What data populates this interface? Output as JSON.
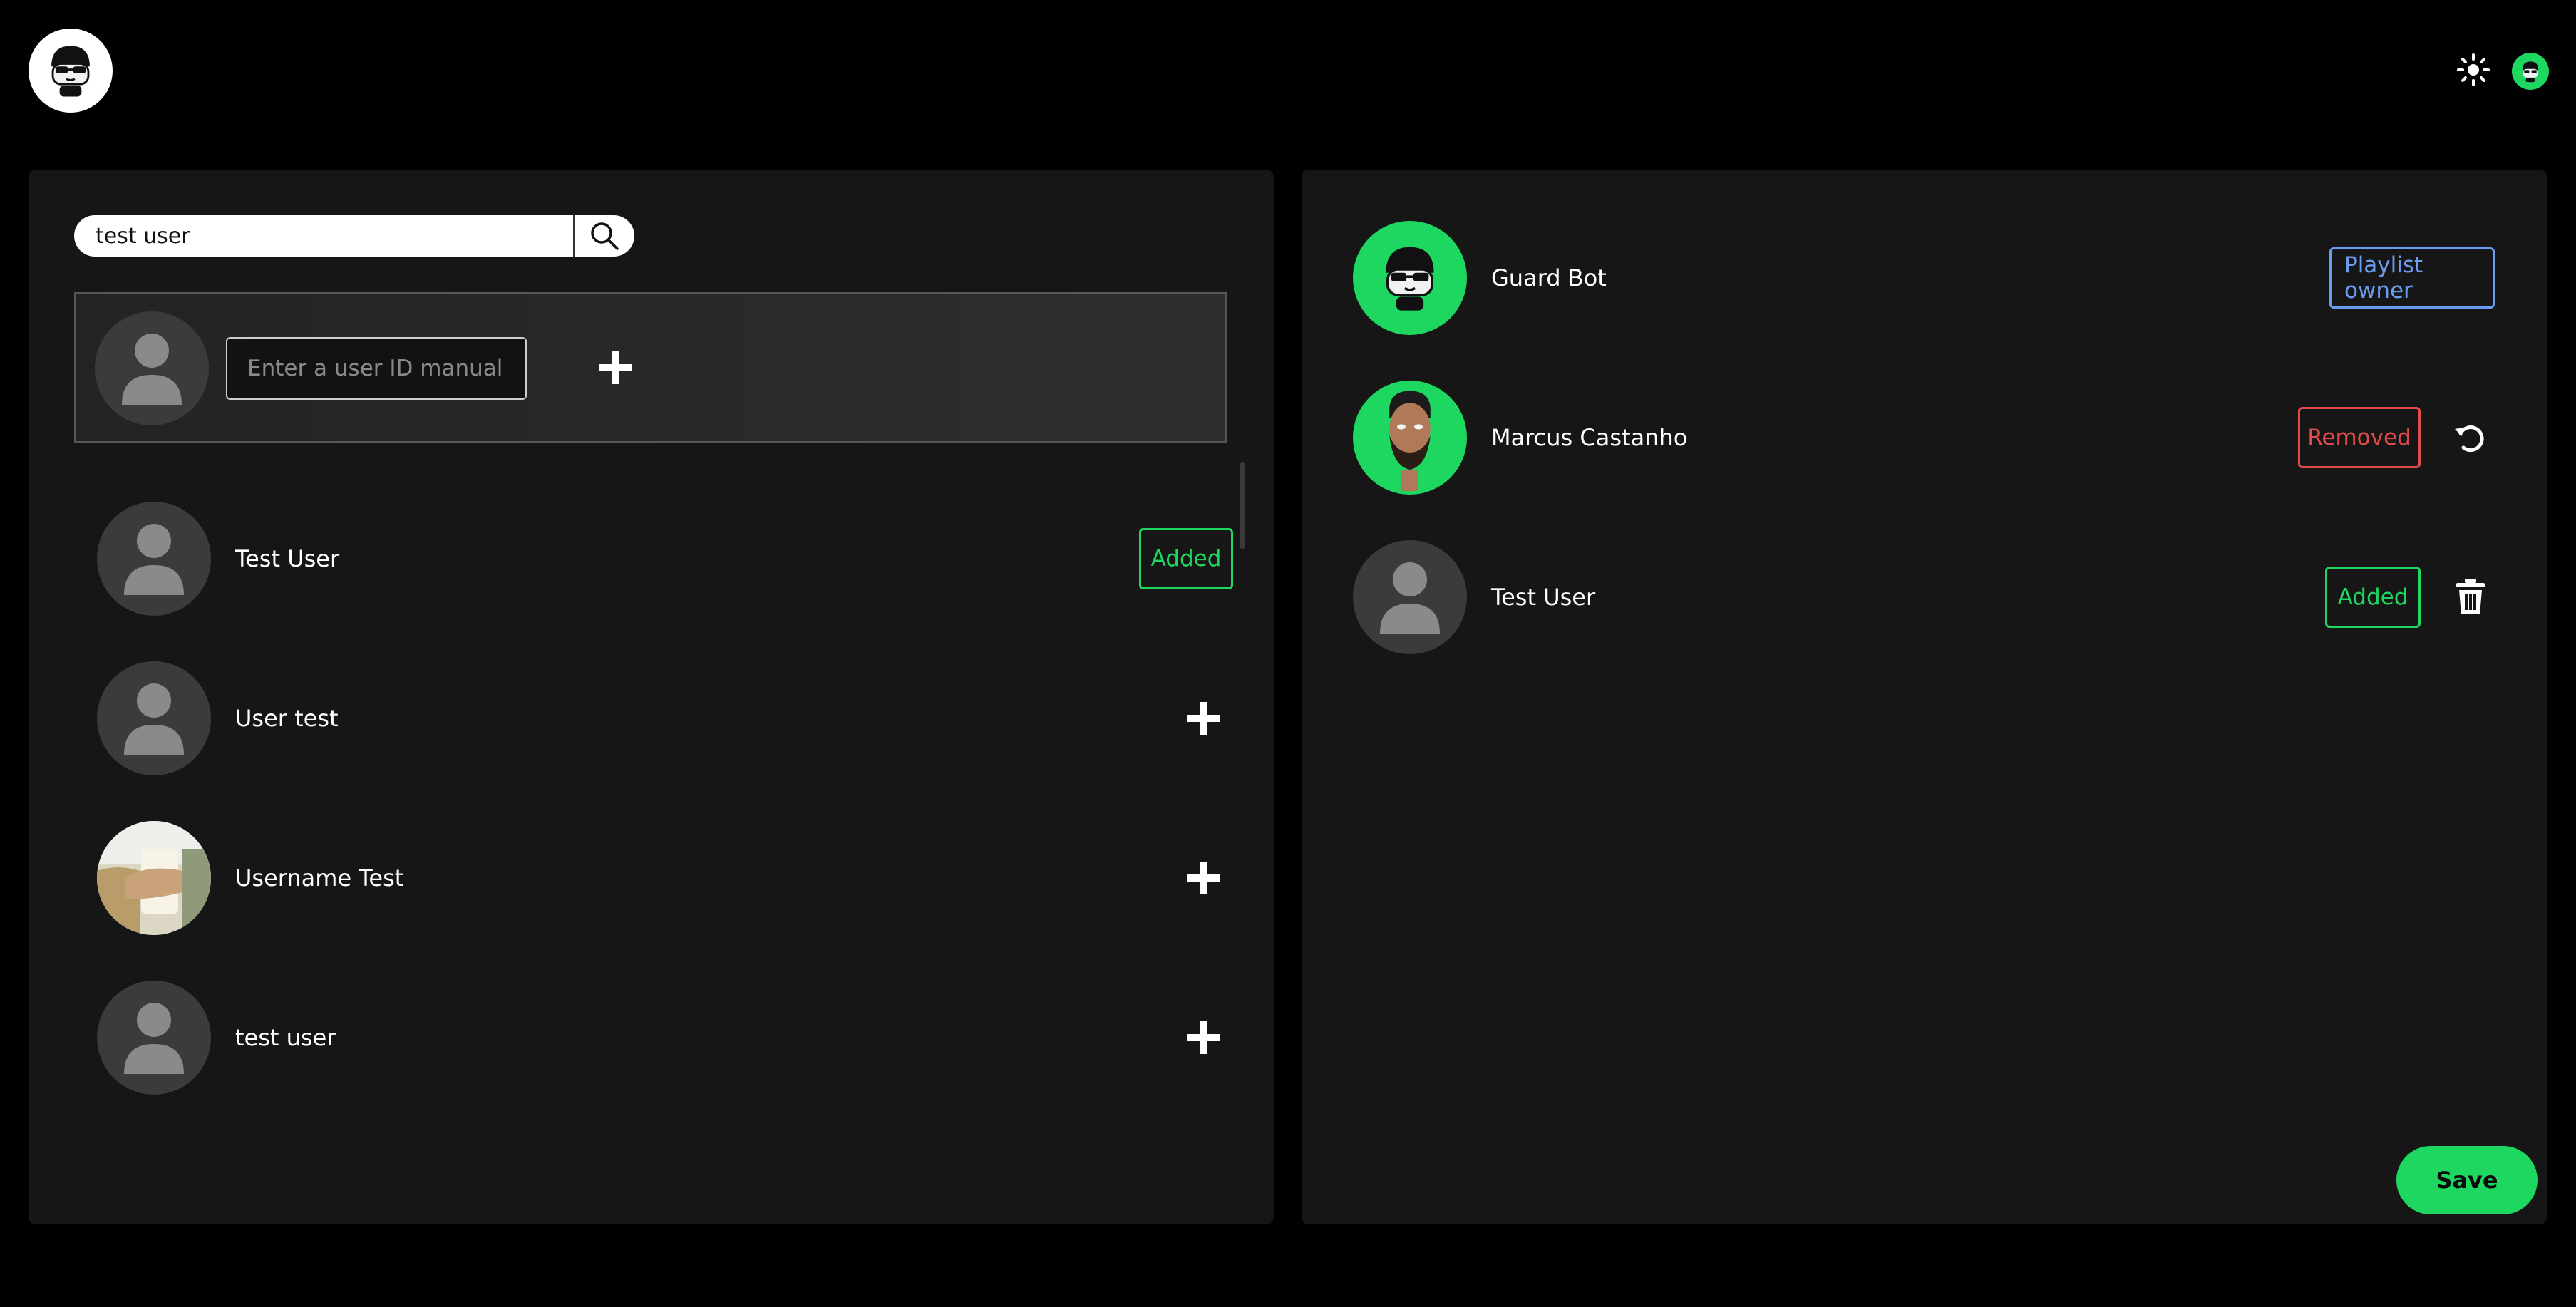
{
  "header": {
    "logo_icon": "robot-face-icon",
    "theme_icon": "sun-icon",
    "profile_icon": "robot-face-icon"
  },
  "colors": {
    "accent": "#1ed760",
    "removed": "#e14b4b",
    "owner": "#6c9cf1",
    "panel": "#161616",
    "background": "#000000"
  },
  "search": {
    "value": "test user",
    "icon": "search-icon"
  },
  "manual_entry": {
    "placeholder": "Enter a user ID manually",
    "add_icon": "plus-icon"
  },
  "results": [
    {
      "name": "Test User",
      "status": "Added",
      "avatar": "default-user-icon"
    },
    {
      "name": "User test",
      "status": "",
      "avatar": "default-user-icon"
    },
    {
      "name": "Username Test",
      "status": "",
      "avatar": "photo-avatar"
    },
    {
      "name": "test user",
      "status": "",
      "avatar": "default-user-icon"
    }
  ],
  "members": [
    {
      "name": "Guard Bot",
      "status": "Playlist owner",
      "avatar": "robot-face-icon",
      "action": ""
    },
    {
      "name": "Marcus Castanho",
      "status": "Removed",
      "avatar": "portrait-avatar",
      "action": "undo-icon"
    },
    {
      "name": "Test User",
      "status": "Added",
      "avatar": "default-user-icon",
      "action": "trash-icon"
    }
  ],
  "save_label": "Save"
}
